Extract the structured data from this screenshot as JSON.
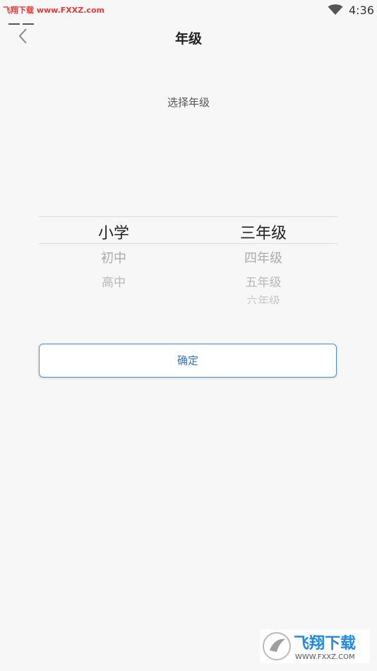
{
  "status_bar": {
    "watermark": "飞翔下载 www.FXXZ.com",
    "time": "4:36"
  },
  "header": {
    "title": "年级",
    "back_icon": "chevron-left-icon"
  },
  "subtitle": "选择年级",
  "picker": {
    "left_column": {
      "selected": "小学",
      "options": [
        "初中",
        "高中"
      ]
    },
    "right_column": {
      "selected": "三年级",
      "options": [
        "四年级",
        "五年级",
        "六年级"
      ]
    }
  },
  "confirm_label": "确定",
  "watermark_logo": {
    "title": "飞翔下载",
    "url": "WWW.FXXZ.COM"
  },
  "colors": {
    "accent": "#2f74c0",
    "border": "#4a90d9",
    "watermark_red": "#e53935"
  }
}
